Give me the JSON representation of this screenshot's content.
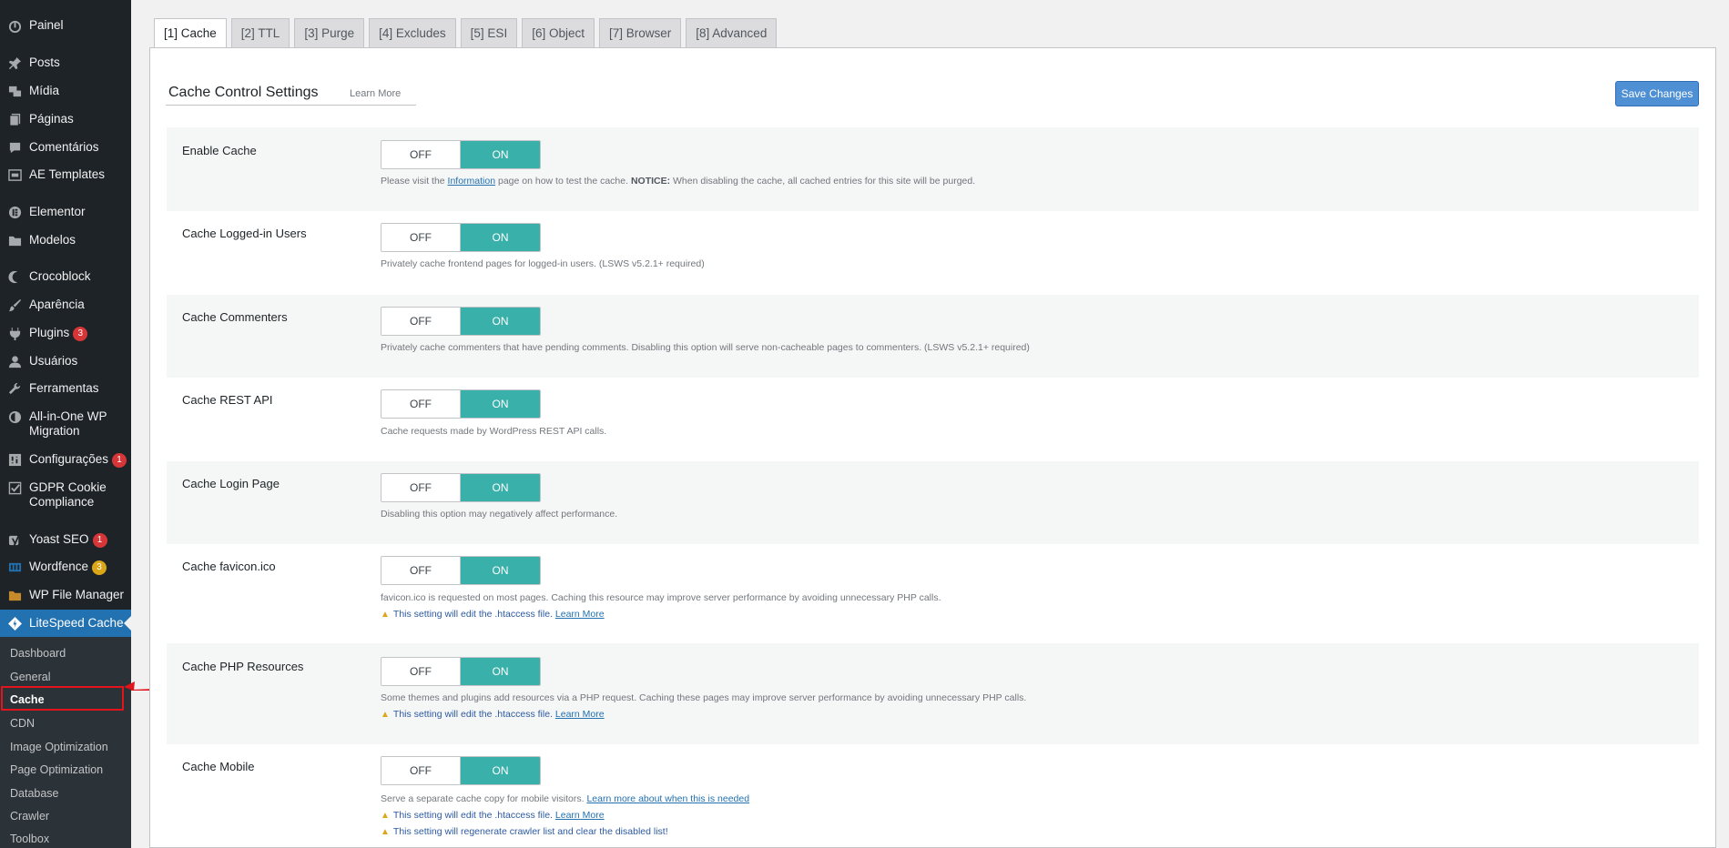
{
  "sidebar": {
    "items": [
      {
        "label": "Painel",
        "icon": "dashboard-icon"
      },
      {
        "label": "Posts",
        "icon": "pin-icon"
      },
      {
        "label": "Mídia",
        "icon": "media-icon"
      },
      {
        "label": "Páginas",
        "icon": "pages-icon"
      },
      {
        "label": "Comentários",
        "icon": "comment-icon"
      },
      {
        "label": "AE Templates",
        "icon": "templates-icon"
      },
      {
        "label": "Elementor",
        "icon": "elementor-icon"
      },
      {
        "label": "Modelos",
        "icon": "folder-icon"
      },
      {
        "label": "Crocoblock",
        "icon": "crocoblock-icon"
      },
      {
        "label": "Aparência",
        "icon": "brush-icon"
      },
      {
        "label": "Plugins",
        "icon": "plugin-icon",
        "badge": "3"
      },
      {
        "label": "Usuários",
        "icon": "user-icon"
      },
      {
        "label": "Ferramentas",
        "icon": "wrench-icon"
      },
      {
        "label": "All-in-One WP Migration",
        "icon": "migration-icon"
      },
      {
        "label": "Configurações",
        "icon": "settings-icon",
        "badge": "1"
      },
      {
        "label": "GDPR Cookie Compliance",
        "icon": "checkbox-icon"
      },
      {
        "label": "Yoast SEO",
        "icon": "yoast-icon",
        "badge": "1"
      },
      {
        "label": "Wordfence",
        "icon": "wordfence-icon",
        "badge": "3"
      },
      {
        "label": "WP File Manager",
        "icon": "file-manager-icon"
      },
      {
        "label": "LiteSpeed Cache",
        "icon": "litespeed-icon"
      }
    ],
    "submenu": [
      "Dashboard",
      "General",
      "Cache",
      "CDN",
      "Image Optimization",
      "Page Optimization",
      "Database",
      "Crawler",
      "Toolbox"
    ]
  },
  "tabs": [
    "[1] Cache",
    "[2] TTL",
    "[3] Purge",
    "[4] Excludes",
    "[5] ESI",
    "[6] Object",
    "[7] Browser",
    "[8] Advanced"
  ],
  "header": {
    "title": "Cache Control Settings",
    "learn_more": "Learn More",
    "save_label": "Save Changes"
  },
  "toggle": {
    "off": "OFF",
    "on": "ON"
  },
  "settings": [
    {
      "label": "Enable Cache",
      "desc_pre": "Please visit the ",
      "desc_link": "Information",
      "desc_mid": " page on how to test the cache. ",
      "desc_notice": "NOTICE:",
      "desc_post": " When disabling the cache, all cached entries for this site will be purged."
    },
    {
      "label": "Cache Logged-in Users",
      "desc": "Privately cache frontend pages for logged-in users. (LSWS v5.2.1+ required)"
    },
    {
      "label": "Cache Commenters",
      "desc": "Privately cache commenters that have pending comments. Disabling this option will serve non-cacheable pages to commenters. (LSWS v5.2.1+ required)"
    },
    {
      "label": "Cache REST API",
      "desc": "Cache requests made by WordPress REST API calls."
    },
    {
      "label": "Cache Login Page",
      "desc": "Disabling this option may negatively affect performance."
    },
    {
      "label": "Cache favicon.ico",
      "desc": "favicon.ico is requested on most pages. Caching this resource may improve server performance by avoiding unnecessary PHP calls.",
      "warn": "This setting will edit the .htaccess file.",
      "warn_link": "Learn More"
    },
    {
      "label": "Cache PHP Resources",
      "desc": "Some themes and plugins add resources via a PHP request. Caching these pages may improve server performance by avoiding unnecessary PHP calls.",
      "warn": "This setting will edit the .htaccess file.",
      "warn_link": "Learn More"
    },
    {
      "label": "Cache Mobile",
      "desc": "Serve a separate cache copy for mobile visitors.",
      "desc_link": "Learn more about when this is needed",
      "warn": "This setting will edit the .htaccess file.",
      "warn_link": "Learn More",
      "warn2": "This setting will regenerate crawler list and clear the disabled list!"
    }
  ],
  "colors": {
    "sidebar_bg": "#1d2327",
    "active": "#2271b1",
    "toggle_on": "#3ab0aa",
    "badge": "#d63638",
    "highlight": "#e3141b"
  }
}
